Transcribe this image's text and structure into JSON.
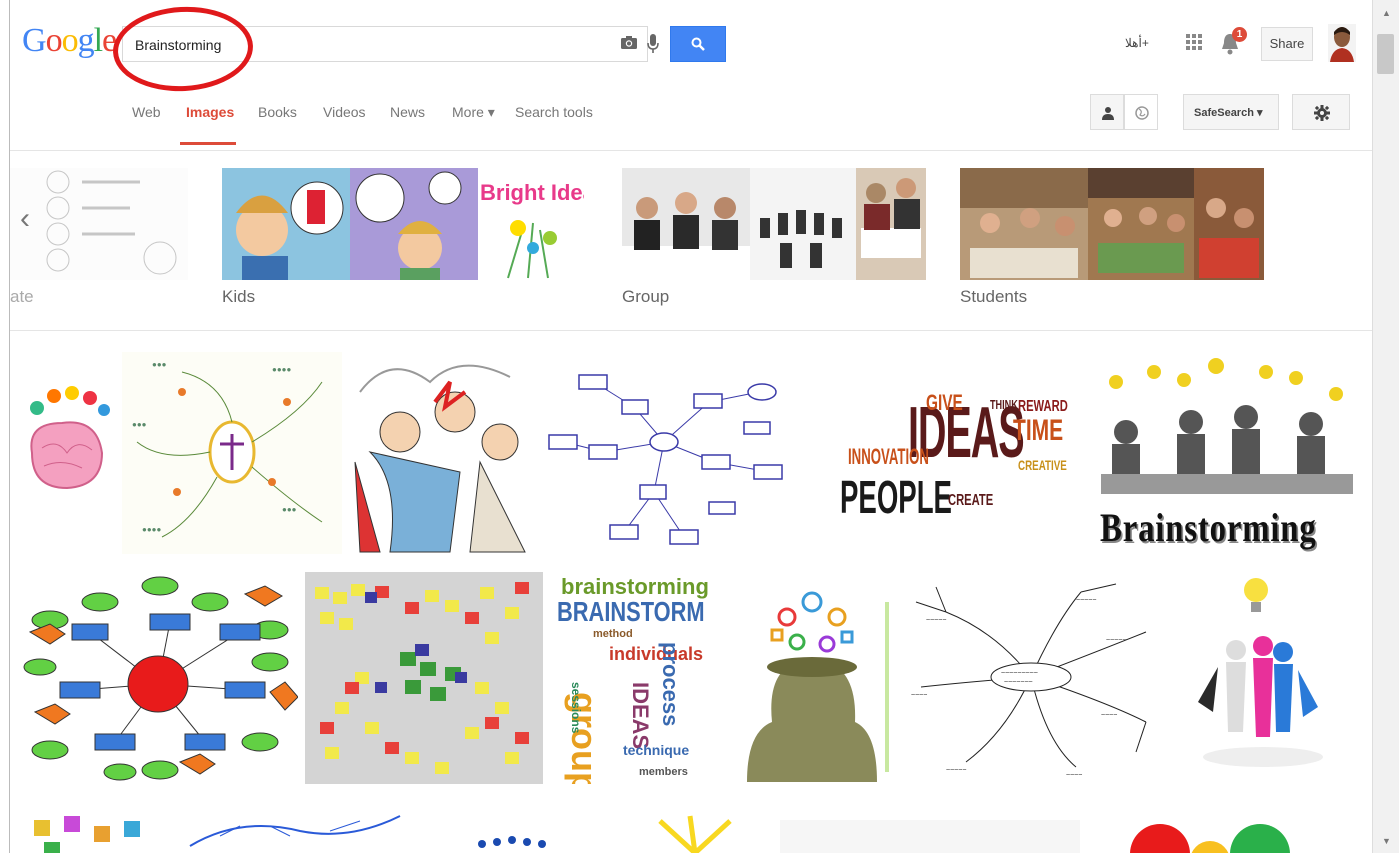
{
  "search": {
    "query": "Brainstorming"
  },
  "logo": {
    "letters": [
      "G",
      "o",
      "o",
      "g",
      "l",
      "e"
    ],
    "colors": [
      "#4285f4",
      "#ea4335",
      "#fbbc05",
      "#4285f4",
      "#34a853",
      "#ea4335"
    ]
  },
  "header": {
    "language_link": "أهلا+",
    "share_label": "Share",
    "notification_count": "1"
  },
  "nav": {
    "tabs": [
      "Web",
      "Images",
      "Books",
      "Videos",
      "News",
      "More ▾",
      "Search tools"
    ],
    "active_tab": "Images",
    "safesearch_label": "SafeSearch ▾"
  },
  "related": {
    "partial_label": "ate",
    "groups": [
      "Kids",
      "Group",
      "Students"
    ]
  },
  "results": {
    "banner_word": "Brainstorming",
    "cloud_words": {
      "ideas": "IDEAS",
      "people": "PEOPLE",
      "innovation": "INNOVATION",
      "time": "TIME",
      "give": "GIVE",
      "create": "CREATE",
      "creative": "CREATIVE",
      "think": "THINK",
      "reward": "REWARD",
      "brainstorming": "brainstorming",
      "brainstorm": "BRAINSTORM",
      "individuals": "individuals",
      "process": "process",
      "group": "group",
      "technique": "technique",
      "sessions": "sessions",
      "members": "members",
      "method": "method"
    },
    "bright_idea": "Bright Idea"
  },
  "colors": {
    "accent_red": "#dd4b39",
    "search_blue": "#4285f4",
    "annotation_red": "#e0191b"
  }
}
